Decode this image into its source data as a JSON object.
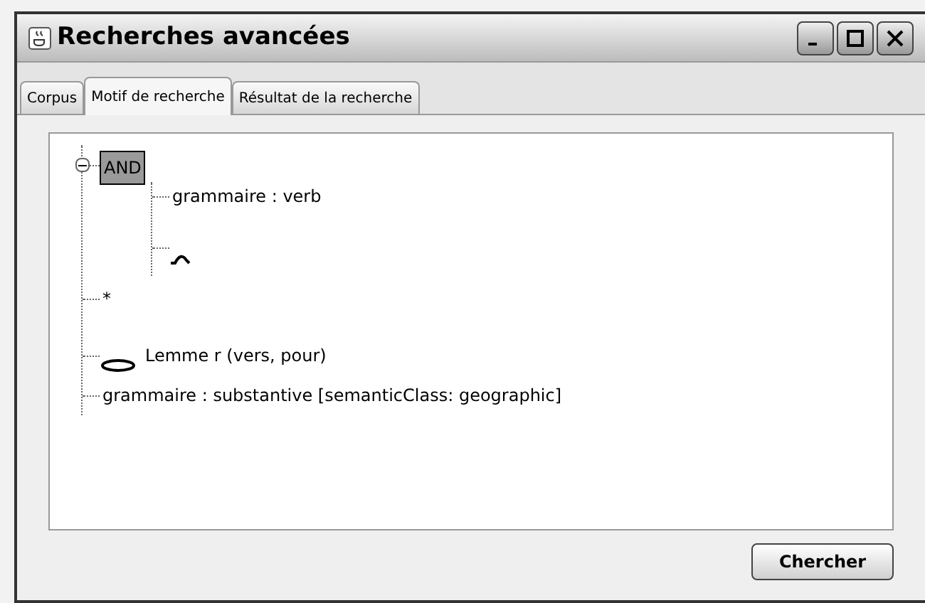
{
  "window": {
    "title": "Recherches avancées"
  },
  "tabs": [
    {
      "label": "Corpus",
      "selected": false
    },
    {
      "label": "Motif de recherche",
      "selected": true
    },
    {
      "label": "Résultat de la recherche",
      "selected": false
    }
  ],
  "tree": [
    {
      "kind": "operator",
      "label": "AND",
      "selected": true,
      "expanded": true,
      "children": [
        {
          "kind": "text",
          "label": "grammaire : verb",
          "selected": false
        },
        {
          "kind": "arc"
        }
      ]
    },
    {
      "kind": "text",
      "label": "*",
      "selected": false
    },
    {
      "kind": "oval",
      "label": "Lemme r (vers, pour)",
      "selected": false
    },
    {
      "kind": "text",
      "label": "grammaire : substantive [semanticClass: geographic]",
      "selected": false
    }
  ],
  "buttons": [
    "Chercher"
  ]
}
